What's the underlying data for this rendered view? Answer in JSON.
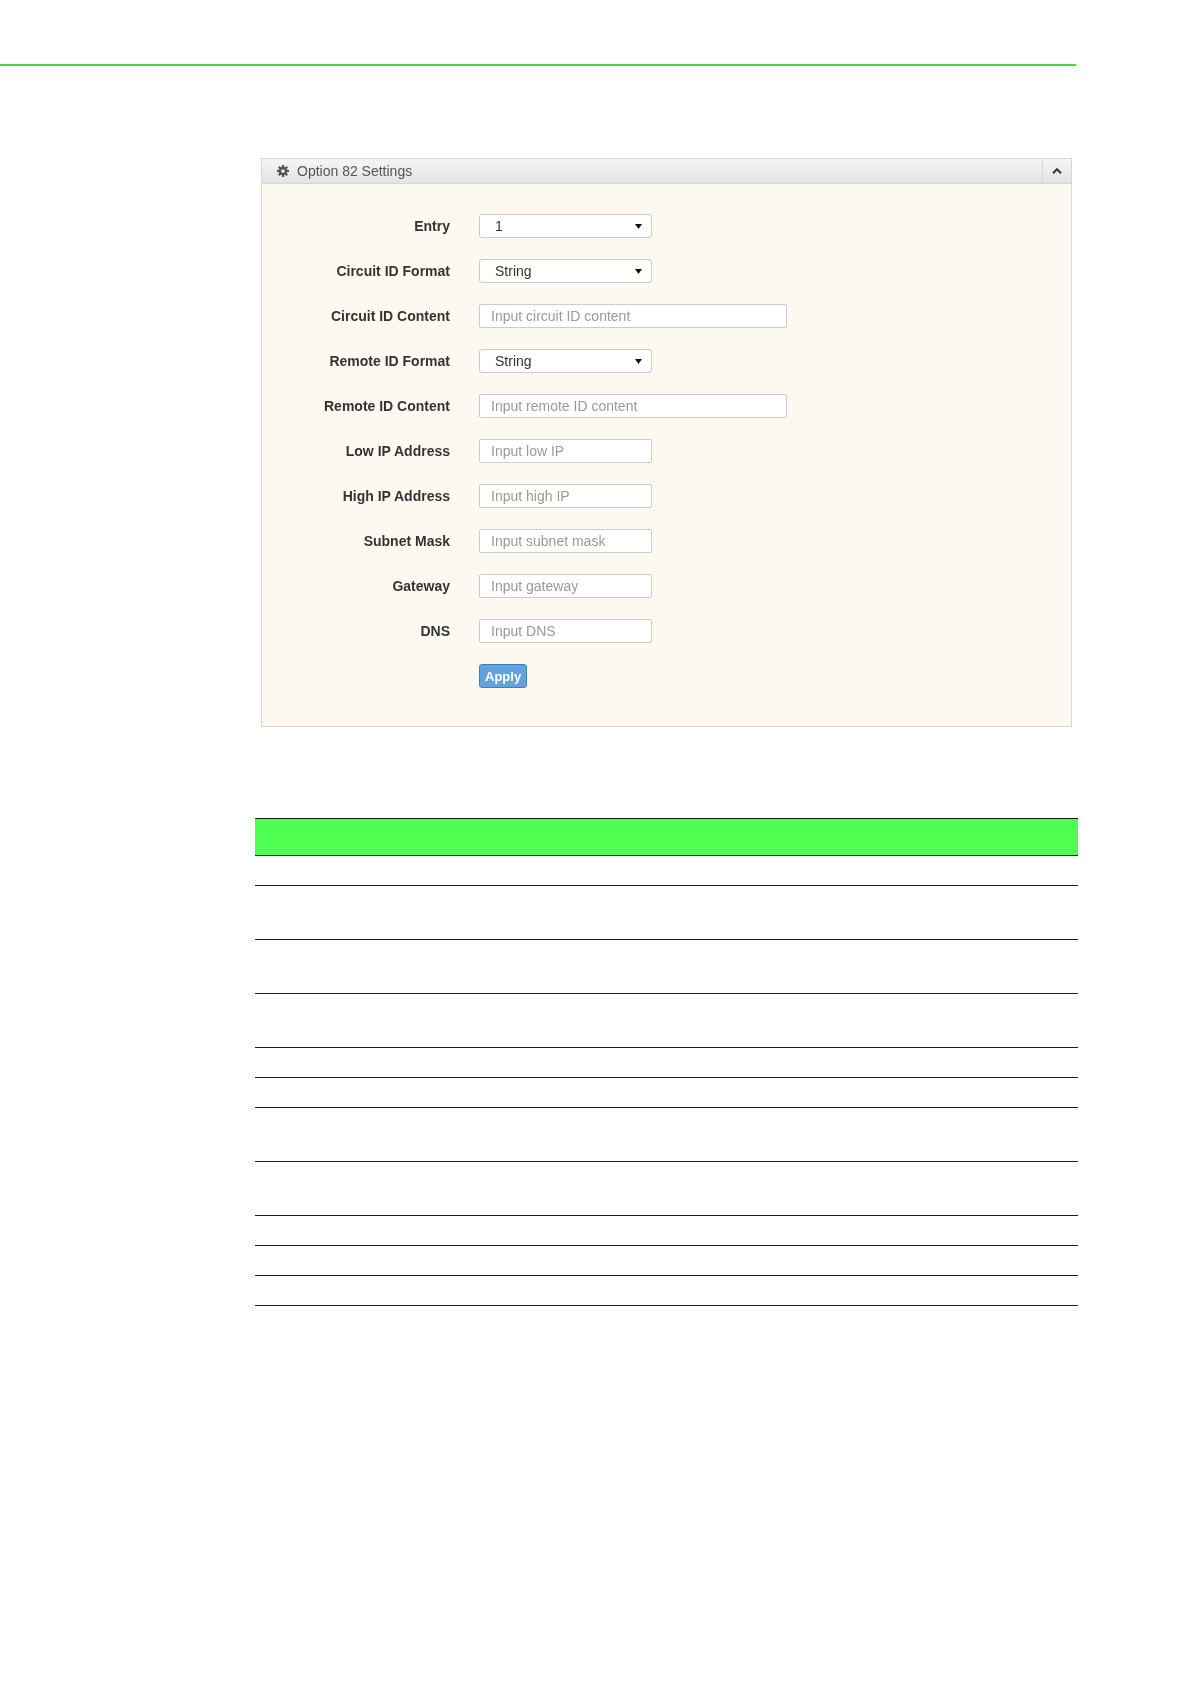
{
  "panel": {
    "title": "Option 82 Settings",
    "expanded": true
  },
  "fields": [
    {
      "label": "Entry",
      "kind": "select",
      "value": "1"
    },
    {
      "label": "Circuit ID Format",
      "kind": "select",
      "value": "String"
    },
    {
      "label": "Circuit ID Content",
      "kind": "longtext",
      "placeholder": "Input circuit ID content"
    },
    {
      "label": "Remote ID Format",
      "kind": "select",
      "value": "String"
    },
    {
      "label": "Remote ID Content",
      "kind": "longtext",
      "placeholder": "Input remote ID content"
    },
    {
      "label": "Low IP Address",
      "kind": "text",
      "placeholder": "Input low IP"
    },
    {
      "label": "High IP Address",
      "kind": "text",
      "placeholder": "Input high IP"
    },
    {
      "label": "Subnet Mask",
      "kind": "text",
      "placeholder": "Input subnet mask"
    },
    {
      "label": "Gateway",
      "kind": "text",
      "placeholder": "Input gateway"
    },
    {
      "label": "DNS",
      "kind": "text",
      "placeholder": "Input DNS"
    }
  ],
  "button": "Apply",
  "table": {
    "rows": [
      {
        "kind": "short"
      },
      {
        "kind": "tall"
      },
      {
        "kind": "tall"
      },
      {
        "kind": "tall"
      },
      {
        "kind": "short"
      },
      {
        "kind": "short"
      },
      {
        "kind": "tall"
      },
      {
        "kind": "tall"
      },
      {
        "kind": "short"
      },
      {
        "kind": "short"
      },
      {
        "kind": "short"
      }
    ]
  }
}
